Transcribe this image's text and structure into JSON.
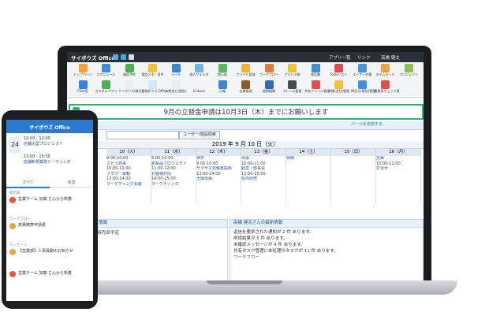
{
  "app": {
    "brand": "サイボウズ Office",
    "header_links": [
      "アプリ一覧",
      "リンク",
      "高橋 健太"
    ]
  },
  "apps": [
    {
      "label": "トップページ",
      "color": "#f4a33a"
    },
    {
      "label": "スケジュール",
      "color": "#3b8ed6"
    },
    {
      "label": "施設予約",
      "color": "#4bb34e"
    },
    {
      "label": "電話メモ・用件",
      "color": "#f2c23b"
    },
    {
      "label": "メール",
      "color": "#3c86d1"
    },
    {
      "label": "個人フォルダ",
      "color": "#6fb5e7"
    },
    {
      "label": "掲示板",
      "color": "#58b85c"
    },
    {
      "label": "ファイル管理",
      "color": "#f0b23e"
    },
    {
      "label": "ワークフロー",
      "color": "#e07b38"
    },
    {
      "label": "アドレス帳",
      "color": "#f2c23b"
    },
    {
      "label": "報告書",
      "color": "#3f8fd4"
    },
    {
      "label": "ToDoリスト",
      "color": "#d65050"
    },
    {
      "label": "ユーザー名簿",
      "color": "#4a95d9"
    },
    {
      "label": "タイムカード",
      "color": "#f0a33a"
    },
    {
      "label": "プロジェクト",
      "color": "#8cc152"
    },
    {
      "label": "CBの窓",
      "color": "#2e86de"
    },
    {
      "label": "カスタムアプリ",
      "color": "#4fae55"
    },
    {
      "label": "サイボウズ(株式会社)",
      "color": "#e8eef5"
    },
    {
      "label": "サイボウズ Office",
      "color": "#d7e7f8"
    },
    {
      "label": "お問合せ(個別)",
      "color": "#e8eef5"
    },
    {
      "label": "kintone",
      "color": "#f4f4f4"
    },
    {
      "label": "日報",
      "color": "#3c86d1"
    },
    {
      "label": "在庫管理",
      "color": "#8b5a2b"
    },
    {
      "label": "経費精算",
      "color": "#2e6db5"
    },
    {
      "label": "クレーム管理",
      "color": "#444b54"
    },
    {
      "label": "共有ファイル管理",
      "color": "#e04e4e"
    },
    {
      "label": "申請(全社)管理",
      "color": "#f2c23b"
    },
    {
      "label": "問合せ(個別)管理",
      "color": "#3e8fd8"
    },
    {
      "label": "業務用チェック表",
      "color": "#e04e4e"
    }
  ],
  "banner": {
    "text": "9月の立替金申請は10月3日（木）までにお願いします"
  },
  "portal_link": "パーツを追加する",
  "search": {
    "button": "ユーザー/施設検索"
  },
  "calendar": {
    "title": "2019 年 9 月 10 日（火）",
    "days": [
      "10（火）",
      "11（水）",
      "12（木）",
      "13（金）",
      "14（土）",
      "15（日）",
      "16（月）"
    ],
    "events": [
      [
        "9:00-10:00",
        "さとう商事",
        "10:00-11:00",
        "フラワー運輸",
        "13:00-14:00",
        "マーケティング会議"
      ],
      [
        "9:00-10:00",
        "新製品プロジェクト",
        "11:00-12:00",
        "お客様対応",
        "14:00-15:00",
        "マーケティング"
      ],
      [
        "休日",
        "9:00-10:00",
        "サクサス見積書提出",
        "13:00-14:00",
        "大阪出張"
      ],
      [
        "出張",
        "10:00-11:00",
        "経営・部長会",
        "13:00-15:00",
        "社内研修"
      ],
      [
        "休暇"
      ],
      [],
      [
        "先輩",
        "10:00-11:00",
        "打合せ"
      ]
    ]
  },
  "panels": {
    "left_title": "アプリ - 売上情報",
    "left_sub": "比較(1～) 期待売却予定",
    "right_title": "高橋 健太さんの最新情報",
    "right_items": [
      "返信を要求された通知が 2 件 あります。",
      "申請結果が 5 件 あります。",
      "未確認メッセージが 4 件 あります。",
      "共有タスク管理に未処理のタスクが 11 件 あります。"
    ],
    "right_section": "ワークフロー"
  },
  "phone": {
    "title": "サイボウズ Office",
    "date_num": "24",
    "event1_time": "10:00 - 12:00",
    "event1": "店舗大型プロジェクト",
    "event2_time": "13:00 - 15:00",
    "event2": "店舗新規業務ミーティング",
    "tabs": [
      "すべて",
      "未読"
    ],
    "notif_section": "掲示板",
    "notif1": "営業チーム 加藤 さんから新着",
    "workflow_section": "ワークフロー",
    "notif2": "旅費精算申請書",
    "message_section": "メッセージ",
    "notif3": "【営業部】人事異動のお知らせ",
    "notif4": "営業チーム 加藤 さんから新着"
  }
}
